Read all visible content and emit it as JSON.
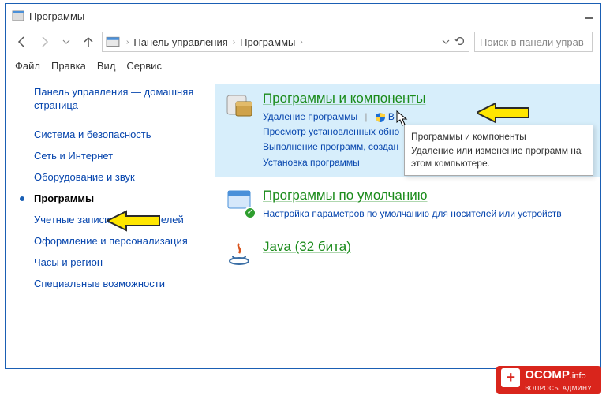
{
  "title": "Программы",
  "breadcrumb": {
    "item1": "Панель управления",
    "item2": "Программы"
  },
  "search": {
    "placeholder": "Поиск в панели управ"
  },
  "menu": {
    "file": "Файл",
    "edit": "Правка",
    "view": "Вид",
    "tools": "Сервис"
  },
  "sidebar": {
    "home": "Панель управления — домашняя страница",
    "items": [
      {
        "label": "Система и безопасность"
      },
      {
        "label": "Сеть и Интернет"
      },
      {
        "label": "Оборудование и звук"
      },
      {
        "label": "Программы",
        "active": true
      },
      {
        "label": "Учетные записи пользователей"
      },
      {
        "label": "Оформление и персонализация"
      },
      {
        "label": "Часы и регион"
      },
      {
        "label": "Специальные возможности"
      }
    ]
  },
  "sections": {
    "programs": {
      "title": "Программы и компоненты",
      "link1": "Удаление программы",
      "link2_prefix": "В",
      "link3": "Просмотр установленных обно",
      "link4": "Выполнение программ, создан",
      "link5": "Установка программы"
    },
    "defaults": {
      "title": "Программы по умолчанию",
      "link1": "Настройка параметров по умолчанию для носителей или устройств"
    },
    "java": {
      "title": "Java (32 бита)"
    }
  },
  "tooltip": {
    "title": "Программы и компоненты",
    "body": "Удаление или изменение программ на этом компьютере."
  },
  "watermark": {
    "brand": "OCOMP",
    "domain": ".info",
    "sub": "ВОПРОСЫ АДМИНУ"
  }
}
